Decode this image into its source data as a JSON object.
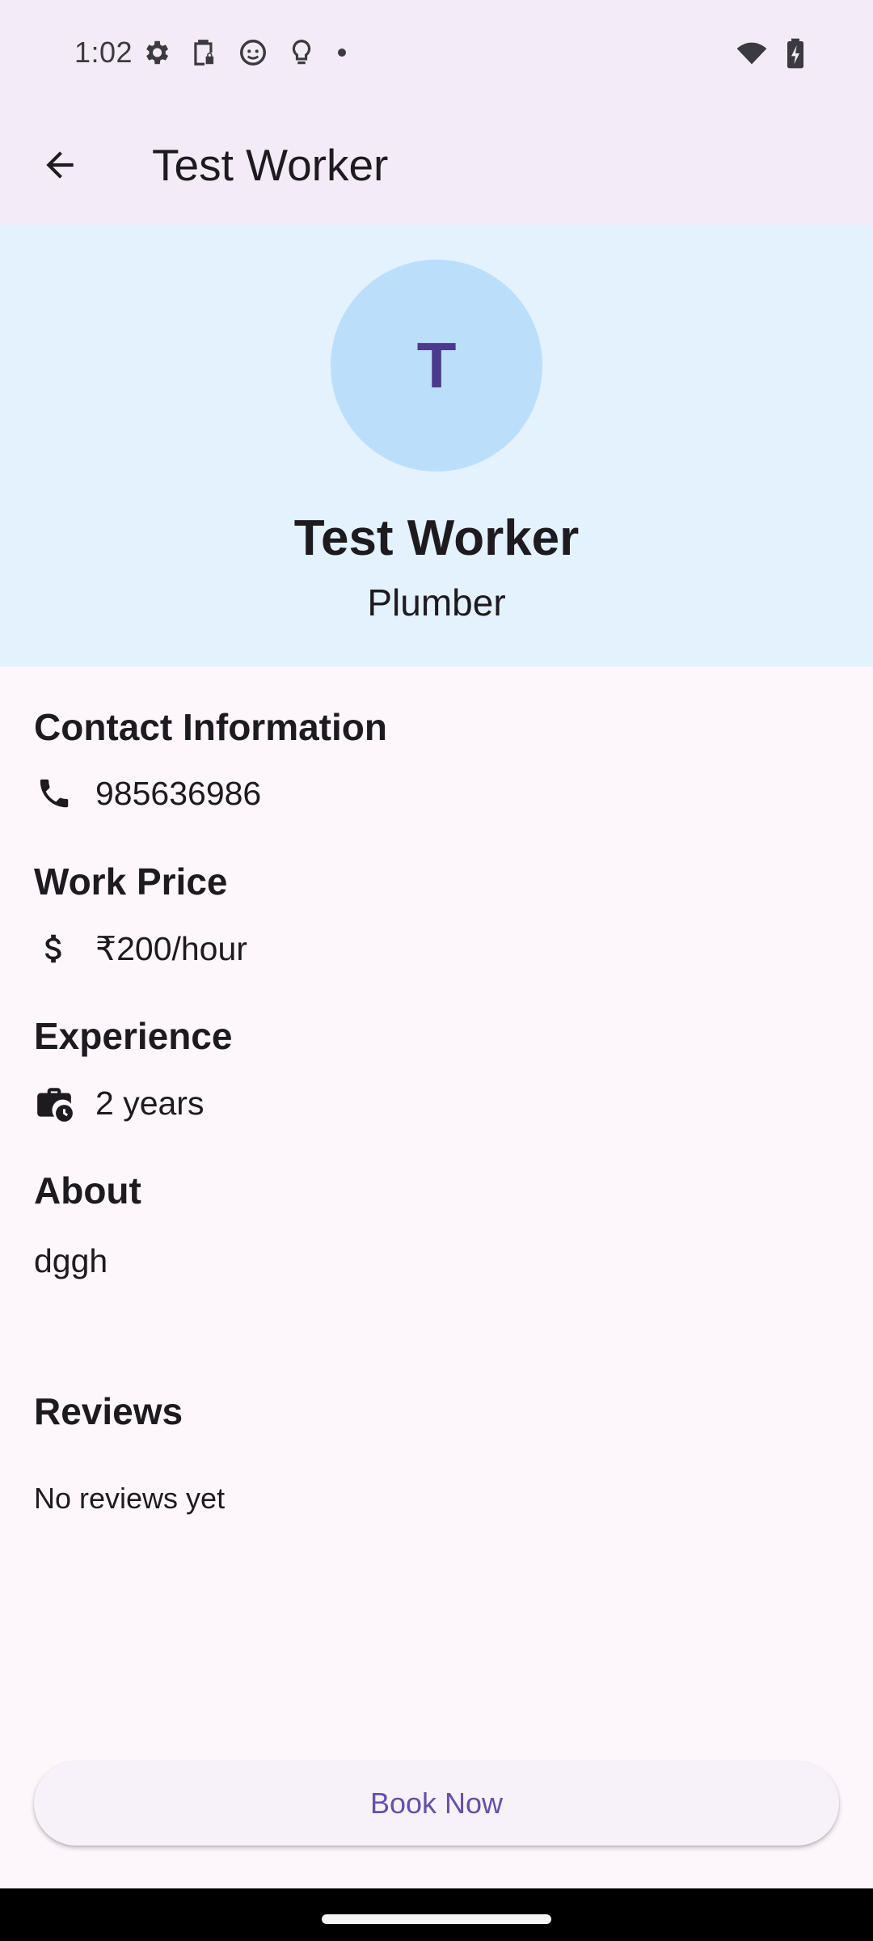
{
  "status_bar": {
    "time": "1:02",
    "left_icons": [
      "settings-icon",
      "clipboard-lock-icon",
      "cat-face-icon",
      "lightbulb-icon",
      "dot-icon"
    ],
    "right_icons": [
      "wifi-icon",
      "battery-charging-icon"
    ]
  },
  "app_bar": {
    "title": "Test Worker",
    "back_icon": "arrow-back-icon"
  },
  "profile": {
    "avatar_initial": "T",
    "name": "Test Worker",
    "profession": "Plumber",
    "header_bg": "#e3f2fd",
    "avatar_bg": "#bbdefb",
    "avatar_text_color": "#4a3a8c"
  },
  "contact": {
    "title": "Contact Information",
    "phone": "985636986",
    "icon": "phone-icon"
  },
  "work_price": {
    "title": "Work Price",
    "price": "₹200/hour",
    "icon": "dollar-icon"
  },
  "experience": {
    "title": "Experience",
    "value": "2 years",
    "icon": "work-history-icon"
  },
  "about": {
    "title": "About",
    "text": "dggh"
  },
  "reviews": {
    "title": "Reviews",
    "empty_text": "No reviews yet"
  },
  "actions": {
    "book_label": "Book Now",
    "accent": "#6750a4"
  }
}
